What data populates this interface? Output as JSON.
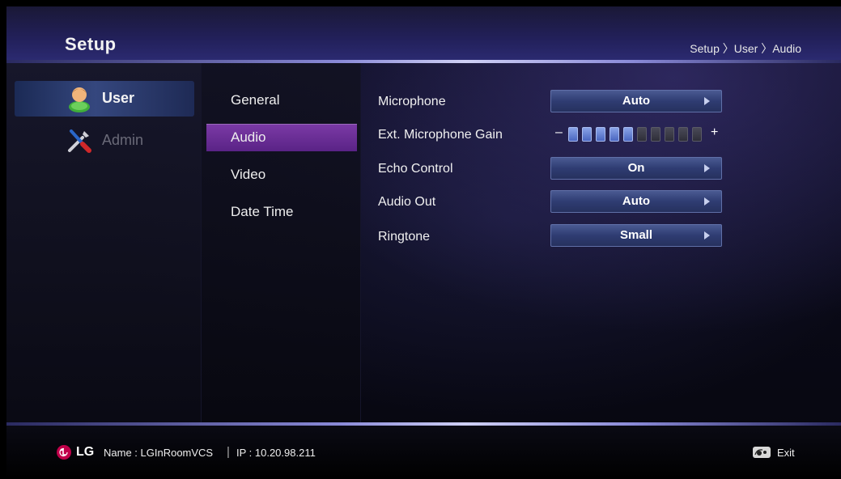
{
  "header": {
    "title": "Setup",
    "breadcrumb": "Setup 〉User 〉Audio"
  },
  "categories": [
    {
      "label": "User",
      "icon": "user-icon",
      "selected": true
    },
    {
      "label": "Admin",
      "icon": "tools-icon",
      "selected": false
    }
  ],
  "submenu": [
    {
      "label": "General",
      "selected": false
    },
    {
      "label": "Audio",
      "selected": true
    },
    {
      "label": "Video",
      "selected": false
    },
    {
      "label": "Date Time",
      "selected": false
    }
  ],
  "settings": {
    "microphone": {
      "label": "Microphone",
      "value": "Auto"
    },
    "gain": {
      "label": "Ext. Microphone Gain",
      "minus": "–",
      "plus": "+",
      "level": 5,
      "max": 10
    },
    "echo": {
      "label": "Echo Control",
      "value": "On"
    },
    "audio_out": {
      "label": "Audio Out",
      "value": "Auto"
    },
    "ringtone": {
      "label": "Ringtone",
      "value": "Small"
    }
  },
  "footer": {
    "brand": "LG",
    "name": "Name : LGInRoomVCS",
    "separator": "|",
    "ip": "IP : 10.20.98.211",
    "exit": "Exit"
  },
  "colors": {
    "accent_purple": "#6a2d96",
    "button_blue": "#34437a",
    "gain_on": "#6a86d8",
    "lg_red": "#c0004a"
  }
}
